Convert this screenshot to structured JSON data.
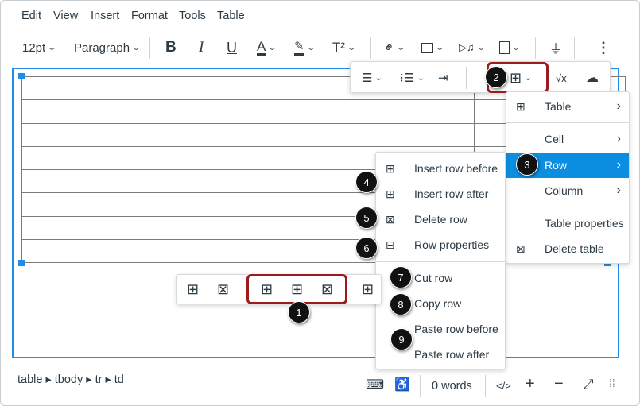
{
  "menubar": [
    "Edit",
    "View",
    "Insert",
    "Format",
    "Tools",
    "Table"
  ],
  "toolbar": {
    "font_size": "12pt",
    "block_format": "Paragraph",
    "bold": "B",
    "italic": "I",
    "underline": "U",
    "text_color": "A",
    "superscript": "T²",
    "math": "√x"
  },
  "table_menu": {
    "items": [
      {
        "label": "Table",
        "icon": "table-icon",
        "submenu": true
      },
      {
        "label": "Cell",
        "submenu": true
      },
      {
        "label": "Row",
        "submenu": true,
        "highlighted": true
      },
      {
        "label": "Column",
        "submenu": true
      },
      {
        "label": "Table properties"
      },
      {
        "label": "Delete table",
        "icon": "delete-table-icon"
      }
    ]
  },
  "row_menu": {
    "items": [
      {
        "label": "Insert row before",
        "icon": "insert-row-before-icon"
      },
      {
        "label": "Insert row after",
        "icon": "insert-row-after-icon"
      },
      {
        "label": "Delete row",
        "icon": "delete-row-icon"
      },
      {
        "label": "Row properties",
        "icon": "row-properties-icon"
      },
      {
        "label": "Cut row"
      },
      {
        "label": "Copy row"
      },
      {
        "label": "Paste row before"
      },
      {
        "label": "Paste row after"
      }
    ]
  },
  "badges": [
    "1",
    "2",
    "3",
    "4",
    "5",
    "6",
    "7",
    "8",
    "9"
  ],
  "statusbar": {
    "path": "table ▸ tbody ▸ tr ▸ td",
    "word_count": "0 words",
    "html_toggle": "</>"
  },
  "colors": {
    "accent": "#0b8ee0",
    "callout_border": "#9b1b1f",
    "badge": "#111111"
  }
}
